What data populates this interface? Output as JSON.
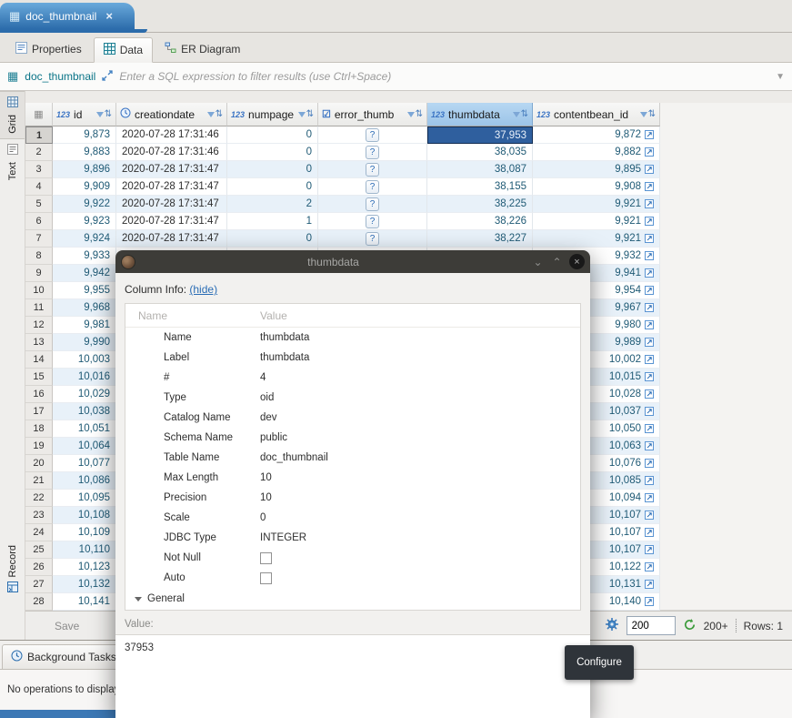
{
  "editor_tab": {
    "label": "doc_thumbnail"
  },
  "tabs": [
    {
      "label": "Properties",
      "active": false
    },
    {
      "label": "Data",
      "active": true
    },
    {
      "label": "ER Diagram",
      "active": false
    }
  ],
  "filter_bar": {
    "table_name": "doc_thumbnail",
    "placeholder": "Enter a SQL expression to filter results (use Ctrl+Space)"
  },
  "side_toolbar": {
    "grid": "Grid",
    "text": "Text",
    "record": "Record"
  },
  "grid": {
    "columns": [
      {
        "label": "id",
        "type": "numeric"
      },
      {
        "label": "creationdate",
        "type": "datetime"
      },
      {
        "label": "numpage",
        "type": "numeric"
      },
      {
        "label": "error_thumb",
        "type": "boolean"
      },
      {
        "label": "thumbdata",
        "type": "numeric",
        "selected": true
      },
      {
        "label": "contentbean_id",
        "type": "numeric"
      }
    ],
    "rows": [
      {
        "n": 1,
        "id": "9,873",
        "date": "2020-07-28 17:31:46",
        "np": "0",
        "err": "?",
        "thumb": "37,953",
        "cb": "9,872",
        "selected": true
      },
      {
        "n": 2,
        "id": "9,883",
        "date": "2020-07-28 17:31:46",
        "np": "0",
        "err": "?",
        "thumb": "38,035",
        "cb": "9,882"
      },
      {
        "n": 3,
        "id": "9,896",
        "date": "2020-07-28 17:31:47",
        "np": "0",
        "err": "?",
        "thumb": "38,087",
        "cb": "9,895"
      },
      {
        "n": 4,
        "id": "9,909",
        "date": "2020-07-28 17:31:47",
        "np": "0",
        "err": "?",
        "thumb": "38,155",
        "cb": "9,908"
      },
      {
        "n": 5,
        "id": "9,922",
        "date": "2020-07-28 17:31:47",
        "np": "2",
        "err": "?",
        "thumb": "38,225",
        "cb": "9,921"
      },
      {
        "n": 6,
        "id": "9,923",
        "date": "2020-07-28 17:31:47",
        "np": "1",
        "err": "?",
        "thumb": "38,226",
        "cb": "9,921"
      },
      {
        "n": 7,
        "id": "9,924",
        "date": "2020-07-28 17:31:47",
        "np": "0",
        "err": "?",
        "thumb": "38,227",
        "cb": "9,921"
      },
      {
        "n": 8,
        "id": "9,933",
        "cb": "9,932"
      },
      {
        "n": 9,
        "id": "9,942",
        "cb": "9,941"
      },
      {
        "n": 10,
        "id": "9,955",
        "cb": "9,954"
      },
      {
        "n": 11,
        "id": "9,968",
        "cb": "9,967"
      },
      {
        "n": 12,
        "id": "9,981",
        "cb": "9,980"
      },
      {
        "n": 13,
        "id": "9,990",
        "cb": "9,989"
      },
      {
        "n": 14,
        "id": "10,003",
        "cb": "10,002"
      },
      {
        "n": 15,
        "id": "10,016",
        "cb": "10,015"
      },
      {
        "n": 16,
        "id": "10,029",
        "cb": "10,028"
      },
      {
        "n": 17,
        "id": "10,038",
        "cb": "10,037"
      },
      {
        "n": 18,
        "id": "10,051",
        "cb": "10,050"
      },
      {
        "n": 19,
        "id": "10,064",
        "cb": "10,063"
      },
      {
        "n": 20,
        "id": "10,077",
        "cb": "10,076"
      },
      {
        "n": 21,
        "id": "10,086",
        "cb": "10,085"
      },
      {
        "n": 22,
        "id": "10,095",
        "cb": "10,094"
      },
      {
        "n": 23,
        "id": "10,108",
        "cb": "10,107"
      },
      {
        "n": 24,
        "id": "10,109",
        "cb": "10,107"
      },
      {
        "n": 25,
        "id": "10,110",
        "cb": "10,107"
      },
      {
        "n": 26,
        "id": "10,123",
        "cb": "10,122"
      },
      {
        "n": 27,
        "id": "10,132",
        "cb": "10,131"
      },
      {
        "n": 28,
        "id": "10,141",
        "cb": "10,140"
      }
    ]
  },
  "bottom_bar": {
    "save_label": "Save",
    "fetch_size": "200",
    "fetch_more_label": "200+",
    "rows_label": "Rows: 1"
  },
  "tooltip": {
    "label": "Configure"
  },
  "dialog": {
    "title": "thumbdata",
    "column_info_label": "Column Info:",
    "hide_link": "(hide)",
    "table_headers": [
      "Name",
      "Value"
    ],
    "properties": [
      {
        "name": "Name",
        "value": "thumbdata"
      },
      {
        "name": "Label",
        "value": "thumbdata"
      },
      {
        "name": "#",
        "value": "4"
      },
      {
        "name": "Type",
        "value": "oid"
      },
      {
        "name": "Catalog Name",
        "value": "dev"
      },
      {
        "name": "Schema Name",
        "value": "public"
      },
      {
        "name": "Table Name",
        "value": "doc_thumbnail"
      },
      {
        "name": "Max Length",
        "value": "10"
      },
      {
        "name": "Precision",
        "value": "10"
      },
      {
        "name": "Scale",
        "value": "0"
      },
      {
        "name": "JDBC Type",
        "value": "INTEGER"
      },
      {
        "name": "Not Null",
        "value": "checkbox"
      },
      {
        "name": "Auto",
        "value": "checkbox"
      }
    ],
    "general_label": "General",
    "value_label": "Value:",
    "value": "37953"
  },
  "background_tasks": {
    "title": "Background Tasks",
    "message": "No operations to display at this time."
  },
  "icons": {
    "table": "▦",
    "close": "×",
    "numeric": "123",
    "boolean": "☑",
    "sort_filter": "⇅",
    "chevron_down": "⌄",
    "chevron_up": "⌃",
    "question": "?",
    "funnel_small": "▼"
  },
  "accent_colors": {
    "selection_blue": "#2f5f9e",
    "tab_blue": "#2c6cab",
    "teal_text": "#0a7487"
  }
}
